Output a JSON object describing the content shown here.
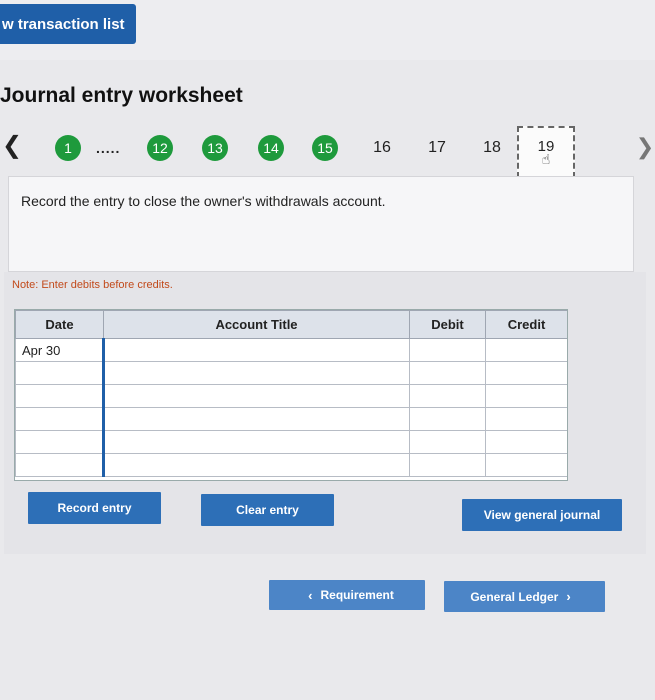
{
  "top": {
    "view_transaction_list": "w transaction list"
  },
  "page_title": "Journal entry worksheet",
  "stepper": {
    "prev_icon": "chevron-left-icon",
    "next_icon": "chevron-right-icon",
    "first": "1",
    "ellipsis": ".....",
    "completed": [
      "12",
      "13",
      "14",
      "15"
    ],
    "pending": [
      "16",
      "17",
      "18"
    ],
    "current": "19"
  },
  "question": "Record the entry to close the owner's withdrawals account.",
  "note": "Note: Enter debits before credits.",
  "journal": {
    "headers": {
      "date": "Date",
      "account": "Account Title",
      "debit": "Debit",
      "credit": "Credit"
    },
    "rows": [
      {
        "date": "Apr 30",
        "account": "",
        "debit": "",
        "credit": ""
      },
      {
        "date": "",
        "account": "",
        "debit": "",
        "credit": ""
      },
      {
        "date": "",
        "account": "",
        "debit": "",
        "credit": ""
      },
      {
        "date": "",
        "account": "",
        "debit": "",
        "credit": ""
      },
      {
        "date": "",
        "account": "",
        "debit": "",
        "credit": ""
      },
      {
        "date": "",
        "account": "",
        "debit": "",
        "credit": ""
      }
    ]
  },
  "buttons": {
    "record": "Record entry",
    "clear": "Clear entry",
    "view_general_journal": "View general journal",
    "requirement": "Requirement",
    "general_ledger": "General Ledger"
  },
  "colors": {
    "accent": "#2d6fb7",
    "step_done": "#1e9a3c",
    "note": "#c24a1b"
  }
}
